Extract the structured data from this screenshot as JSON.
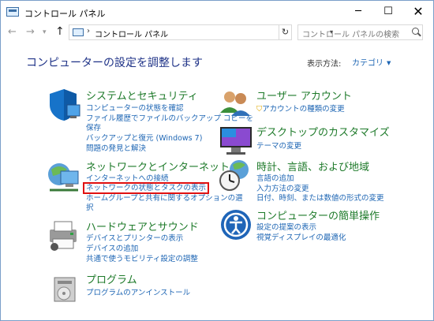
{
  "window": {
    "title": "コントロール パネル"
  },
  "window_controls": {
    "minimize": "─",
    "maximize": "☐",
    "close": "✕"
  },
  "nav": {
    "address_path": "コントロール パネル",
    "search_placeholder": "コントロール パネルの検索"
  },
  "header": {
    "title": "コンピューターの設定を調整します",
    "view_by_label": "表示方法:",
    "view_by_value": "カテゴリ"
  },
  "categories": {
    "system": {
      "title": "システムとセキュリティ",
      "links": [
        "コンピューターの状態を確認",
        "ファイル履歴でファイルのバックアップ コピーを",
        "保存",
        "バックアップと復元 (Windows 7)",
        "問題の発見と解決"
      ]
    },
    "network": {
      "title": "ネットワークとインターネット",
      "links": [
        "インターネットへの接続",
        "ネットワークの状態とタスクの表示",
        "ホームグループと共有に関するオプションの選",
        "択"
      ]
    },
    "hardware": {
      "title": "ハードウェアとサウンド",
      "links": [
        "デバイスとプリンターの表示",
        "デバイスの追加",
        "共通で使うモビリティ設定の調整"
      ]
    },
    "programs": {
      "title": "プログラム",
      "links": [
        "プログラムのアンインストール"
      ]
    },
    "user_accounts": {
      "title": "ユーザー アカウント",
      "links": [
        "アカウントの種類の変更"
      ]
    },
    "appearance": {
      "title": "デスクトップのカスタマイズ",
      "links": [
        "テーマの変更"
      ]
    },
    "clock": {
      "title": "時計、言語、および地域",
      "links": [
        "言語の追加",
        "入力方法の変更",
        "日付、時刻、または数値の形式の変更"
      ]
    },
    "ease": {
      "title": "コンピューターの簡単操作",
      "links": [
        "設定の提案の表示",
        "視覚ディスプレイの最適化"
      ]
    }
  },
  "colors": {
    "link": "#1e66b4",
    "category_title": "#1e7a2a",
    "heading": "#1e3287",
    "highlight_box": "#e01010"
  }
}
